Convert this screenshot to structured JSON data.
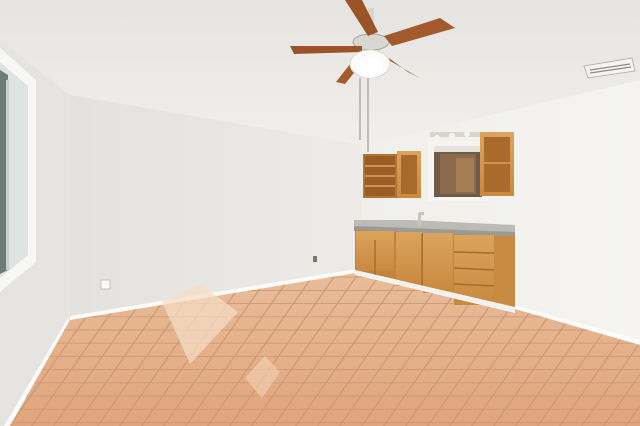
{
  "scene": {
    "type": "photo",
    "colors": {
      "ceiling": "#eeece8",
      "wall_left": "#eae8e4",
      "wall_right": "#f2f1ee",
      "cabinet": "#d49a52",
      "cabinet_dark": "#b57a36",
      "counter": "#b9b7b2",
      "tile": "#e7b58f",
      "grout": "#c89a79",
      "fan_blade": "#a35a2c"
    }
  }
}
